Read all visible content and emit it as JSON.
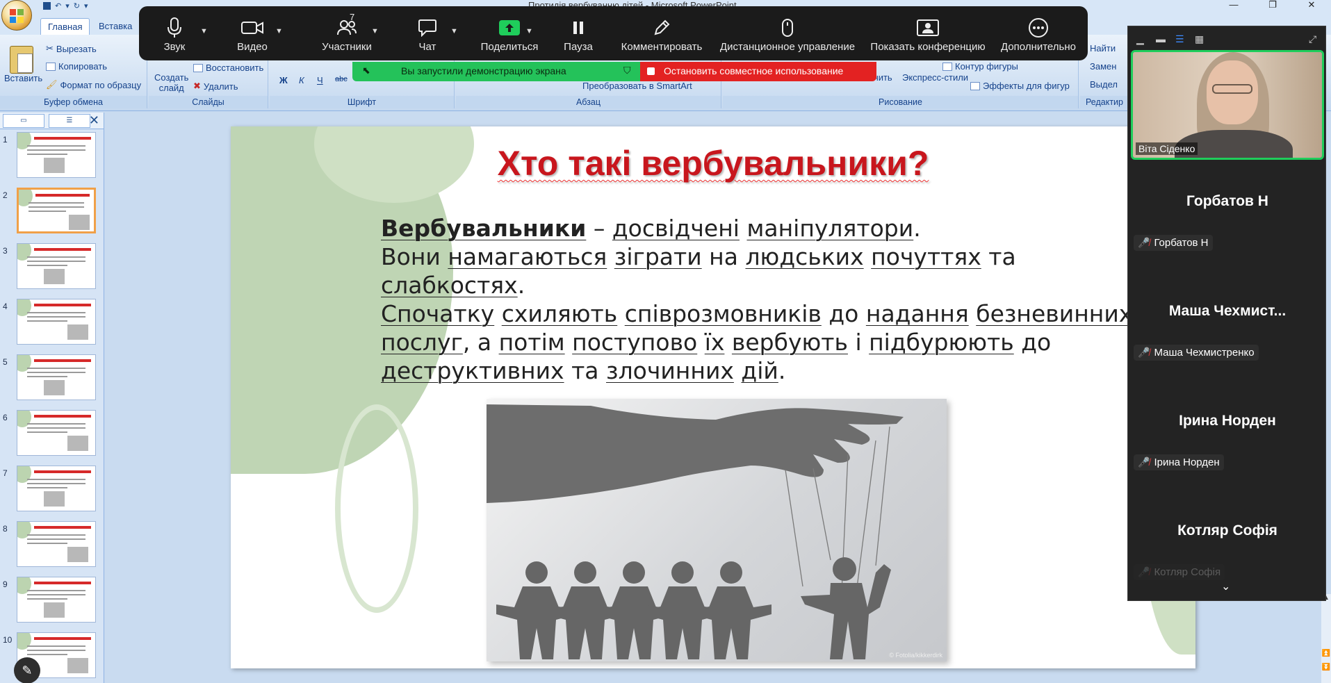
{
  "app": {
    "title": "Протидія вербуванню дітей - Microsoft PowerPoint",
    "window_controls": [
      "—",
      "❐",
      "✕"
    ]
  },
  "ribbon": {
    "tabs": [
      "Главная",
      "Вставка"
    ],
    "groups": {
      "clipboard": {
        "label": "Буфер обмена",
        "paste": "Вставить",
        "cut": "Вырезать",
        "copy": "Копировать",
        "format_painter": "Формат по образцу"
      },
      "slides": {
        "label": "Слайды",
        "create_line1": "Создать",
        "create_line2": "слайд",
        "restore": "Восстановить",
        "delete": "Удалить"
      },
      "font": {
        "label": "Шрифт",
        "bold": "Ж",
        "italic": "К",
        "underline": "Ч",
        "strike": "abc"
      },
      "paragraph": {
        "label": "Абзац",
        "smartart": "Преобразовать в SmartArt"
      },
      "drawing": {
        "label": "Рисование",
        "shape_outline": "Контур фигуры",
        "arrange": "очить",
        "quick_styles": "Экспресс-стили",
        "shape_effects": "Эффекты для фигур"
      },
      "editing": {
        "label": "Редактир",
        "find": "Найти",
        "replace": "Замен",
        "select": "Выдел"
      }
    }
  },
  "slide_panel": {
    "thumbnails": [
      "1",
      "2",
      "3",
      "4",
      "5",
      "6",
      "7",
      "8",
      "9",
      "10"
    ],
    "selected": 2,
    "close": "✕"
  },
  "slide": {
    "title": "Хто такі вербувальники?",
    "body": {
      "lead": "Вербувальники",
      "line1_rest_dash": " – ",
      "w_experienced": "досвідчені",
      "w_manipulators": "маніпулятори",
      "dot": ".",
      "l2_vony": "Вони ",
      "l2_try": "намагаються",
      "l2_play": "зіграти",
      "l2_on": " на ",
      "l2_human": "людських",
      "l2_feelings": "почуттях",
      "l2_and": " та",
      "l3_weak": "слабкостях",
      "l4_first": "Спочатку",
      "l4_incline": "схиляють",
      "l4_interlocutors": "співрозмовників",
      "l4_to": " до ",
      "l4_providing": "надання",
      "l4_innocent": "безневинних",
      "l5_services": "послуг",
      "l5_then": ", а ",
      "l5_then2": "потім",
      "l5_gradually": "поступово",
      "l5_them": "їх",
      "l5_recruit": "вербують",
      "l5_i": " і ",
      "l5_incite": "підбурюють",
      "l5_to": " до",
      "l6_destructive": "деструктивних",
      "l6_and": " та ",
      "l6_criminal": "злочинних",
      "l6_actions": "дій"
    },
    "image_credit": "© Fotolia/kikkerdirk"
  },
  "zoom": {
    "toolbar": [
      {
        "label": "Звук",
        "icon": "mic-icon"
      },
      {
        "label": "Видео",
        "icon": "camera-icon"
      },
      {
        "label": "Участники",
        "icon": "participants-icon",
        "count": "7"
      },
      {
        "label": "Чат",
        "icon": "chat-icon"
      },
      {
        "label": "Поделиться",
        "icon": "share-screen-icon"
      },
      {
        "label": "Пауза",
        "icon": "pause-icon"
      },
      {
        "label": "Комментировать",
        "icon": "pencil-icon"
      },
      {
        "label": "Дистанционное управление",
        "icon": "mouse-icon"
      },
      {
        "label": "Показать конференцию",
        "icon": "show-meeting-icon"
      },
      {
        "label": "Дополнительно",
        "icon": "more-icon"
      }
    ],
    "share_banner": "Вы запустили демонстрацию экрана",
    "stop_share": "Остановить совместное использование",
    "self_video_name": "Віта Сіденко",
    "participants": [
      {
        "big": "Горбатов Н",
        "small": "Горбатов Н"
      },
      {
        "big": "Маша  Чехмист...",
        "small": "Маша Чехмистренко"
      },
      {
        "big": "Ірина Норден",
        "small": "Ірина Норден"
      },
      {
        "big": "Котляр Софія",
        "small": "Котляр Софія"
      }
    ]
  },
  "colors": {
    "title_red": "#c8161d",
    "zoom_green": "#1fcd5b",
    "zoom_red": "#e32222",
    "zoom_bg": "#1b1b1b"
  }
}
